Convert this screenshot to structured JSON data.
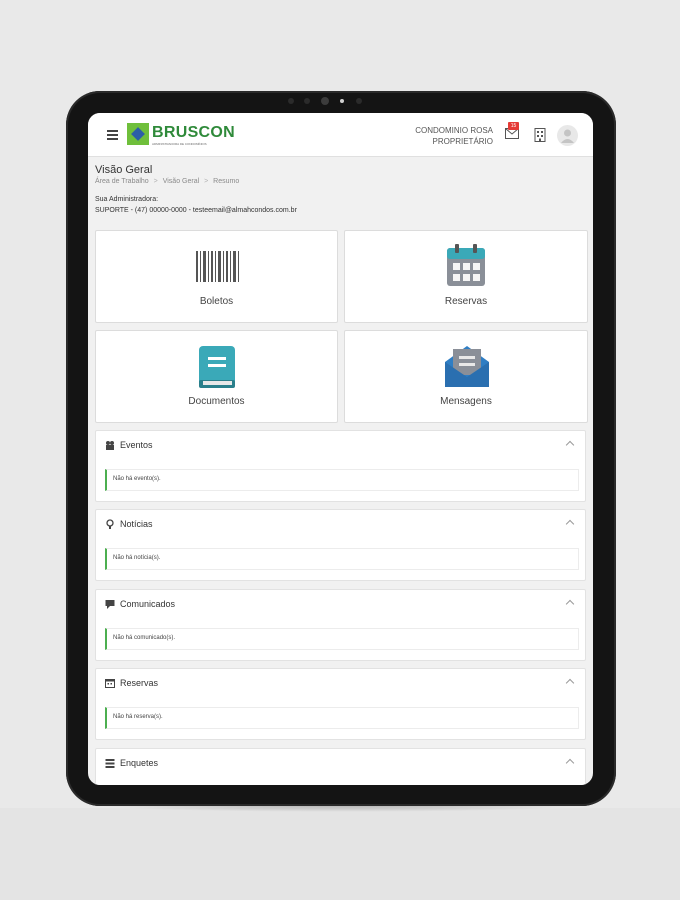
{
  "header": {
    "logo_text": "BRUSCON",
    "logo_sub": "ADMINISTRADORA DE CONDOMÍNIOS",
    "condo_name": "CONDOMINIO ROSA",
    "role": "PROPRIETÁRIO",
    "mail_badge": "15"
  },
  "page": {
    "title": "Visão Geral",
    "breadcrumb": [
      "Área de Trabalho",
      "Visão Geral",
      "Resumo"
    ],
    "breadcrumb_sep": ">",
    "admin_label": "Sua Administradora:",
    "admin_info": "SUPORTE - (47) 00000-0000 - testeemail@almahcondos.com.br"
  },
  "tiles": [
    {
      "label": "Boletos",
      "icon": "barcode-icon"
    },
    {
      "label": "Reservas",
      "icon": "calendar-icon"
    },
    {
      "label": "Documentos",
      "icon": "book-icon"
    },
    {
      "label": "Mensagens",
      "icon": "envelope-icon"
    }
  ],
  "panels": [
    {
      "title": "Eventos",
      "icon": "people-icon",
      "empty": "Não há evento(s)."
    },
    {
      "title": "Notícias",
      "icon": "bulb-icon",
      "empty": "Não há notícia(s)."
    },
    {
      "title": "Comunicados",
      "icon": "chat-icon",
      "empty": "Não há comunicado(s)."
    },
    {
      "title": "Reservas",
      "icon": "calendar-icon",
      "empty": "Não há reserva(s)."
    },
    {
      "title": "Enquetes",
      "icon": "list-icon",
      "empty": ""
    }
  ],
  "colors": {
    "brand_green": "#2f8a3a",
    "accent_green": "#4caf50",
    "badge_red": "#e53935",
    "teal": "#3aa9b8",
    "blue": "#2f7ec4"
  }
}
